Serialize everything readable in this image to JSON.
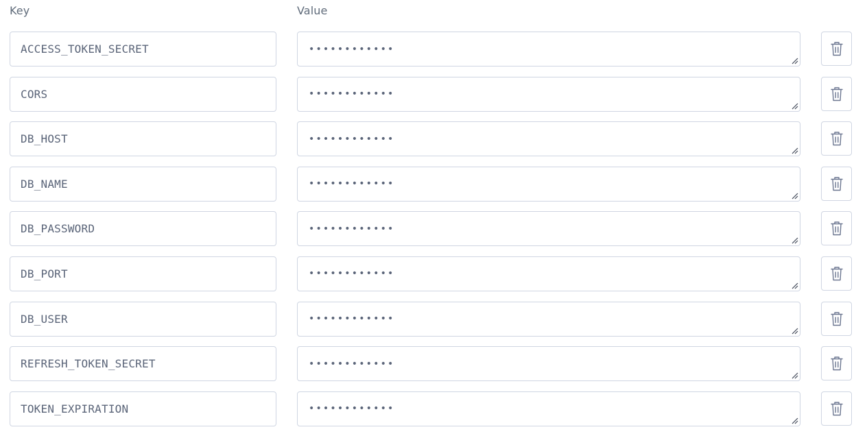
{
  "headers": {
    "key": "Key",
    "value": "Value"
  },
  "env_vars": [
    {
      "key": "ACCESS_TOKEN_SECRET",
      "value": "••••••••••••"
    },
    {
      "key": "CORS",
      "value": "••••••••••••"
    },
    {
      "key": "DB_HOST",
      "value": "••••••••••••"
    },
    {
      "key": "DB_NAME",
      "value": "••••••••••••"
    },
    {
      "key": "DB_PASSWORD",
      "value": "••••••••••••"
    },
    {
      "key": "DB_PORT",
      "value": "••••••••••••"
    },
    {
      "key": "DB_USER",
      "value": "••••••••••••"
    },
    {
      "key": "REFRESH_TOKEN_SECRET",
      "value": "••••••••••••"
    },
    {
      "key": "TOKEN_EXPIRATION",
      "value": "••••••••••••"
    }
  ],
  "icons": {
    "delete": "trash-icon",
    "grip": "resize-grip-icon"
  },
  "colors": {
    "border": "#cfd5e2",
    "text": "#5a6478",
    "icon": "#6b7690"
  }
}
